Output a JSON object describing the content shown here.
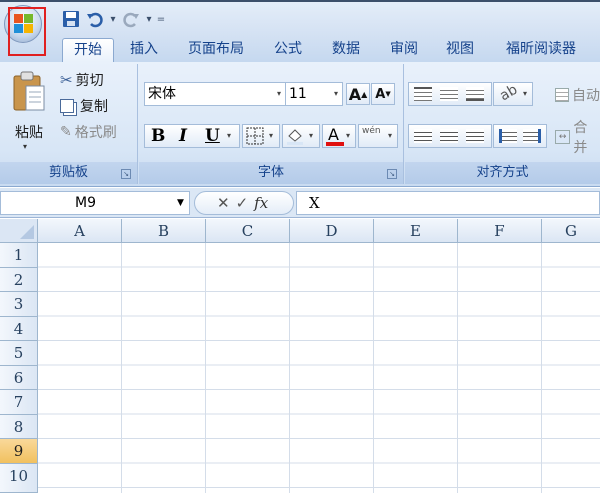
{
  "quick_access": {
    "separator": "="
  },
  "tabs": [
    {
      "label": "开始",
      "active": true
    },
    {
      "label": "插入"
    },
    {
      "label": "页面布局"
    },
    {
      "label": "公式"
    },
    {
      "label": "数据"
    },
    {
      "label": "审阅"
    },
    {
      "label": "视图"
    },
    {
      "label": "福昕阅读器"
    }
  ],
  "clipboard": {
    "paste": "粘贴",
    "cut": "剪切",
    "copy": "复制",
    "format_painter": "格式刷",
    "label": "剪贴板"
  },
  "font": {
    "name": "宋体",
    "size": "11",
    "grow": "A",
    "shrink": "A",
    "bold": "B",
    "italic": "I",
    "underline": "U",
    "font_color": "A",
    "phonetic": "wén",
    "label": "字体"
  },
  "alignment": {
    "wrap": "自动",
    "merge": "合并",
    "label": "对齐方式"
  },
  "formula_bar": {
    "name_box": "M9",
    "cancel": "✕",
    "enter": "✓",
    "fx": "fx",
    "content": "X"
  },
  "grid": {
    "columns": [
      "A",
      "B",
      "C",
      "D",
      "E",
      "F",
      "G"
    ],
    "rows": [
      "1",
      "2",
      "3",
      "4",
      "5",
      "6",
      "7",
      "8",
      "9",
      "10"
    ],
    "selected_row": "9"
  },
  "colors": {
    "highlight_box": "#e02020",
    "font_color_bar": "#e01010",
    "selected_row_header": "#f1c15f"
  }
}
